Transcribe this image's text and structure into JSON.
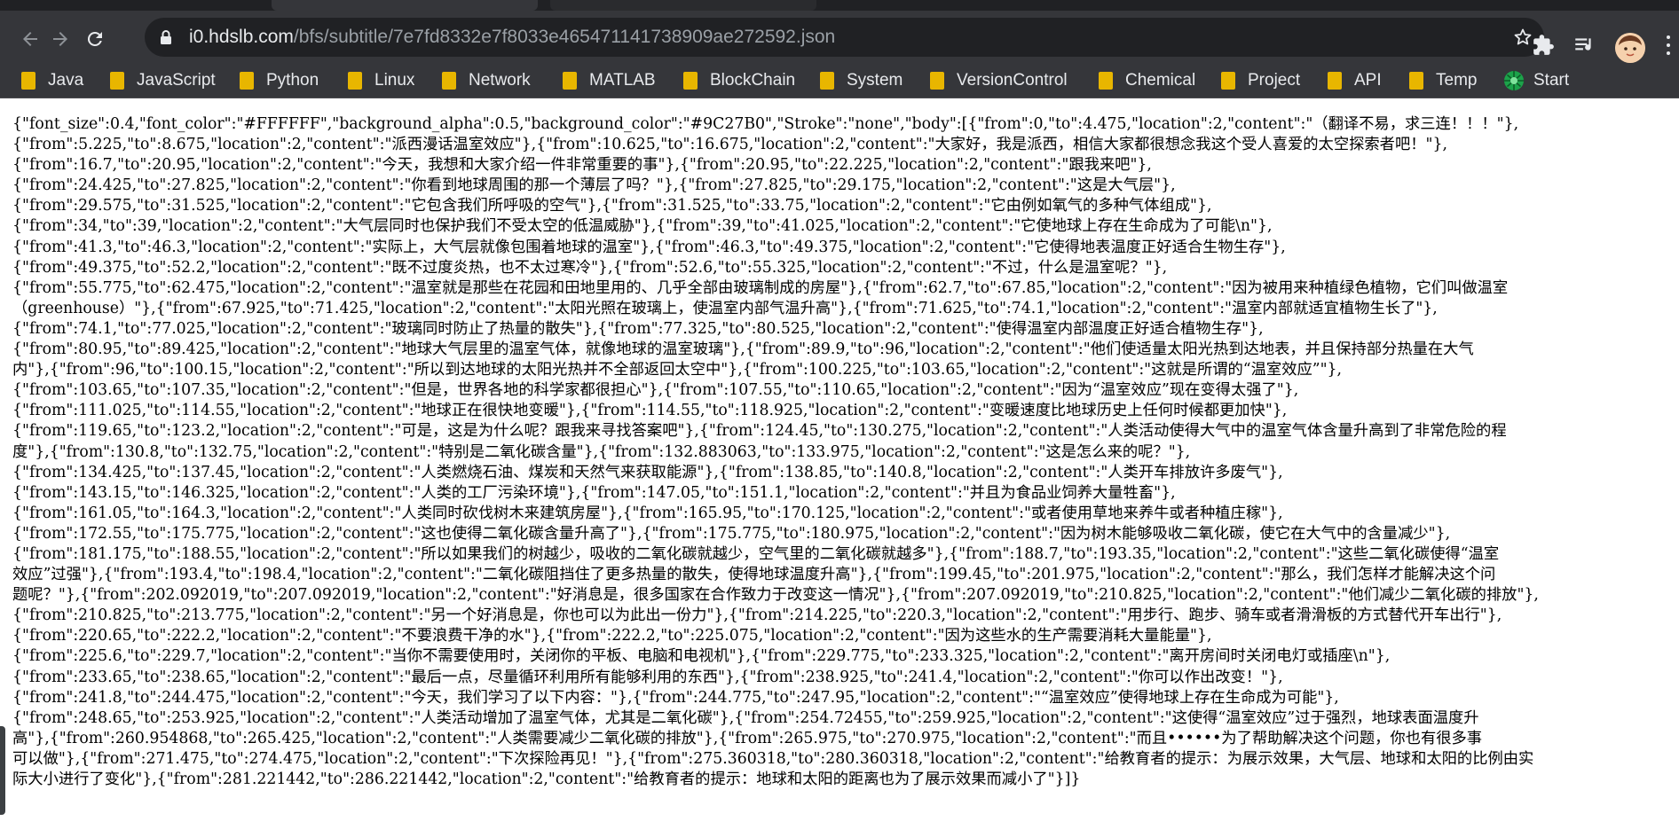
{
  "browser": {
    "url_host": "i0.hdslb.com",
    "url_path": "/bfs/subtitle/7e7fd8332e7f8033e465471141738909ae272592.json"
  },
  "bookmarks": [
    {
      "label": "Java"
    },
    {
      "label": "JavaScript"
    },
    {
      "label": "Python"
    },
    {
      "label": "Linux"
    },
    {
      "label": "Network"
    },
    {
      "label": "MATLAB"
    },
    {
      "label": "BlockChain"
    },
    {
      "label": "System"
    },
    {
      "label": "VersionControl"
    },
    {
      "label": "Chemical"
    },
    {
      "label": "Project"
    },
    {
      "label": "API"
    },
    {
      "label": "Temp"
    },
    {
      "label": "Start"
    }
  ],
  "json_lines": [
    "{\"font_size\":0.4,\"font_color\":\"#FFFFFF\",\"background_alpha\":0.5,\"background_color\":\"#9C27B0\",\"Stroke\":\"none\",\"body\":[{\"from\":0,\"to\":4.475,\"location\":2,\"content\":\"（翻译不易，求三连！！！\"},",
    "{\"from\":5.225,\"to\":8.675,\"location\":2,\"content\":\"派西漫话温室效应\"},{\"from\":10.625,\"to\":16.675,\"location\":2,\"content\":\"大家好，我是派西，相信大家都很想念我这个受人喜爱的太空探索者吧！\"},",
    "{\"from\":16.7,\"to\":20.95,\"location\":2,\"content\":\"今天，我想和大家介绍一件非常重要的事\"},{\"from\":20.95,\"to\":22.225,\"location\":2,\"content\":\"跟我来吧\"},",
    "{\"from\":24.425,\"to\":27.825,\"location\":2,\"content\":\"你看到地球周围的那一个薄层了吗？\"},{\"from\":27.825,\"to\":29.175,\"location\":2,\"content\":\"这是大气层\"},",
    "{\"from\":29.575,\"to\":31.525,\"location\":2,\"content\":\"它包含我们所呼吸的空气\"},{\"from\":31.525,\"to\":33.75,\"location\":2,\"content\":\"它由例如氧气的多种气体组成\"},",
    "{\"from\":34,\"to\":39,\"location\":2,\"content\":\"大气层同时也保护我们不受太空的低温威胁\"},{\"from\":39,\"to\":41.025,\"location\":2,\"content\":\"它使地球上存在生命成为了可能\\n\"},",
    "{\"from\":41.3,\"to\":46.3,\"location\":2,\"content\":\"实际上，大气层就像包围着地球的温室\"},{\"from\":46.3,\"to\":49.375,\"location\":2,\"content\":\"它使得地表温度正好适合生物生存\"},",
    "{\"from\":49.375,\"to\":52.2,\"location\":2,\"content\":\"既不过度炎热，也不太过寒冷\"},{\"from\":52.6,\"to\":55.325,\"location\":2,\"content\":\"不过，什么是温室呢？\"},",
    "{\"from\":55.775,\"to\":62.475,\"location\":2,\"content\":\"温室就是那些在花园和田地里用的、几乎全部由玻璃制成的房屋\"},{\"from\":62.7,\"to\":67.85,\"location\":2,\"content\":\"因为被用来种植绿色植物，它们叫做温室",
    "（greenhouse）\"},{\"from\":67.925,\"to\":71.425,\"location\":2,\"content\":\"太阳光照在玻璃上，使温室内部气温升高\"},{\"from\":71.625,\"to\":74.1,\"location\":2,\"content\":\"温室内部就适宜植物生长了\"},",
    "{\"from\":74.1,\"to\":77.025,\"location\":2,\"content\":\"玻璃同时防止了热量的散失\"},{\"from\":77.325,\"to\":80.525,\"location\":2,\"content\":\"使得温室内部温度正好适合植物生存\"},",
    "{\"from\":80.95,\"to\":89.425,\"location\":2,\"content\":\"地球大气层里的温室气体，就像地球的温室玻璃\"},{\"from\":89.9,\"to\":96,\"location\":2,\"content\":\"他们使适量太阳光热到达地表，并且保持部分热量在大气",
    "内\"},{\"from\":96,\"to\":100.15,\"location\":2,\"content\":\"所以到达地球的太阳光热并不全部返回太空中\"},{\"from\":100.225,\"to\":103.65,\"location\":2,\"content\":\"这就是所谓的“温室效应”\"},",
    "{\"from\":103.65,\"to\":107.35,\"location\":2,\"content\":\"但是，世界各地的科学家都很担心\"},{\"from\":107.55,\"to\":110.65,\"location\":2,\"content\":\"因为“温室效应”现在变得太强了\"},",
    "{\"from\":111.025,\"to\":114.55,\"location\":2,\"content\":\"地球正在很快地变暖\"},{\"from\":114.55,\"to\":118.925,\"location\":2,\"content\":\"变暖速度比地球历史上任何时候都更加快\"},",
    "{\"from\":119.65,\"to\":123.2,\"location\":2,\"content\":\"可是，这是为什么呢？跟我来寻找答案吧\"},{\"from\":124.45,\"to\":130.275,\"location\":2,\"content\":\"人类活动使得大气中的温室气体含量升高到了非常危险的程",
    "度\"},{\"from\":130.8,\"to\":132.75,\"location\":2,\"content\":\"特别是二氧化碳含量\"},{\"from\":132.883063,\"to\":133.975,\"location\":2,\"content\":\"这是怎么来的呢？\"},",
    "{\"from\":134.425,\"to\":137.45,\"location\":2,\"content\":\"人类燃烧石油、煤炭和天然气来获取能源\"},{\"from\":138.85,\"to\":140.8,\"location\":2,\"content\":\"人类开车排放许多废气\"},",
    "{\"from\":143.15,\"to\":146.325,\"location\":2,\"content\":\"人类的工厂污染环境\"},{\"from\":147.05,\"to\":151.1,\"location\":2,\"content\":\"并且为食品业饲养大量牲畜\"},",
    "{\"from\":161.05,\"to\":164.3,\"location\":2,\"content\":\"人类同时砍伐树木来建筑房屋\"},{\"from\":165.95,\"to\":170.125,\"location\":2,\"content\":\"或者使用草地来养牛或者种植庄稼\"},",
    "{\"from\":172.55,\"to\":175.775,\"location\":2,\"content\":\"这也使得二氧化碳含量升高了\"},{\"from\":175.775,\"to\":180.975,\"location\":2,\"content\":\"因为树木能够吸收二氧化碳，使它在大气中的含量减少\"},",
    "{\"from\":181.175,\"to\":188.55,\"location\":2,\"content\":\"所以如果我们的树越少，吸收的二氧化碳就越少，空气里的二氧化碳就越多\"},{\"from\":188.7,\"to\":193.35,\"location\":2,\"content\":\"这些二氧化碳使得“温室",
    "效应”过强\"},{\"from\":193.4,\"to\":198.4,\"location\":2,\"content\":\"二氧化碳阻挡住了更多热量的散失，使得地球温度升高\"},{\"from\":199.45,\"to\":201.975,\"location\":2,\"content\":\"那么，我们怎样才能解决这个问",
    "题呢？\"},{\"from\":202.092019,\"to\":207.092019,\"location\":2,\"content\":\"好消息是，很多国家在合作致力于改变这一情况\"},{\"from\":207.092019,\"to\":210.825,\"location\":2,\"content\":\"他们减少二氧化碳的排放\"},",
    "{\"from\":210.825,\"to\":213.775,\"location\":2,\"content\":\"另一个好消息是，你也可以为此出一份力\"},{\"from\":214.225,\"to\":220.3,\"location\":2,\"content\":\"用步行、跑步、骑车或者滑滑板的方式替代开车出行\"},",
    "{\"from\":220.65,\"to\":222.2,\"location\":2,\"content\":\"不要浪费干净的水\"},{\"from\":222.2,\"to\":225.075,\"location\":2,\"content\":\"因为这些水的生产需要消耗大量能量\"},",
    "{\"from\":225.6,\"to\":229.7,\"location\":2,\"content\":\"当你不需要使用时，关闭你的平板、电脑和电视机\"},{\"from\":229.775,\"to\":233.325,\"location\":2,\"content\":\"离开房间时关闭电灯或插座\\n\"},",
    "{\"from\":233.65,\"to\":238.65,\"location\":2,\"content\":\"最后一点，尽量循环利用所有能够利用的东西\"},{\"from\":238.925,\"to\":241.4,\"location\":2,\"content\":\"你可以作出改变！\"},",
    "{\"from\":241.8,\"to\":244.475,\"location\":2,\"content\":\"今天，我们学习了以下内容：\"},{\"from\":244.775,\"to\":247.95,\"location\":2,\"content\":\"“温室效应”使得地球上存在生命成为可能\"},",
    "{\"from\":248.65,\"to\":253.925,\"location\":2,\"content\":\"人类活动增加了温室气体，尤其是二氧化碳\"},{\"from\":254.72455,\"to\":259.925,\"location\":2,\"content\":\"这使得“温室效应”过于强烈，地球表面温度升",
    "高\"},{\"from\":260.954868,\"to\":265.425,\"location\":2,\"content\":\"人类需要减少二氧化碳的排放\"},{\"from\":265.975,\"to\":270.975,\"location\":2,\"content\":\"而且••••••为了帮助解决这个问题，你也有很多事",
    "可以做\"},{\"from\":271.475,\"to\":274.475,\"location\":2,\"content\":\"下次探险再见！\"},{\"from\":275.360318,\"to\":280.360318,\"location\":2,\"content\":\"给教育者的提示：为展示效果，大气层、地球和太阳的比例由实",
    "际大小进行了变化\"},{\"from\":281.221442,\"to\":286.221442,\"location\":2,\"content\":\"给教育者的提示：地球和太阳的距离也为了展示效果而减小了\"}]}"
  ]
}
